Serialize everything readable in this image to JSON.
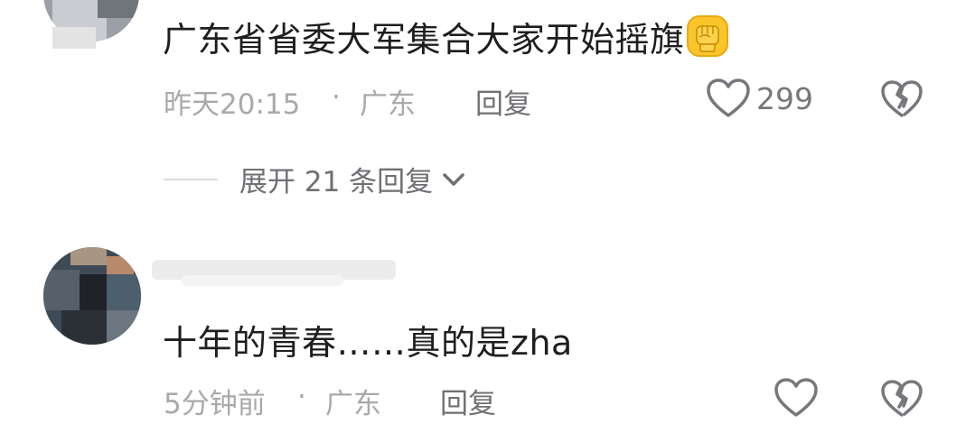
{
  "comments": [
    {
      "text": "广东省省委大军集合大家开始摇旗",
      "emoji_icon": "raised-fist-emoji",
      "time": "昨天20:15",
      "separator": "·",
      "location": "广东",
      "reply_label": "回复",
      "like_count": "299",
      "expand_label": "展开 21 条回复"
    },
    {
      "text": "十年的青春……真的是zha",
      "time": "5分钟前",
      "separator": "·",
      "location": "广东",
      "reply_label": "回复",
      "like_count": ""
    }
  ],
  "icons": {
    "like": "heart-outline-icon",
    "dislike": "broken-heart-icon",
    "expand": "chevron-down-icon"
  },
  "colors": {
    "text": "#1e1e1e",
    "meta": "#a9a9ad",
    "icon": "#77777c"
  }
}
